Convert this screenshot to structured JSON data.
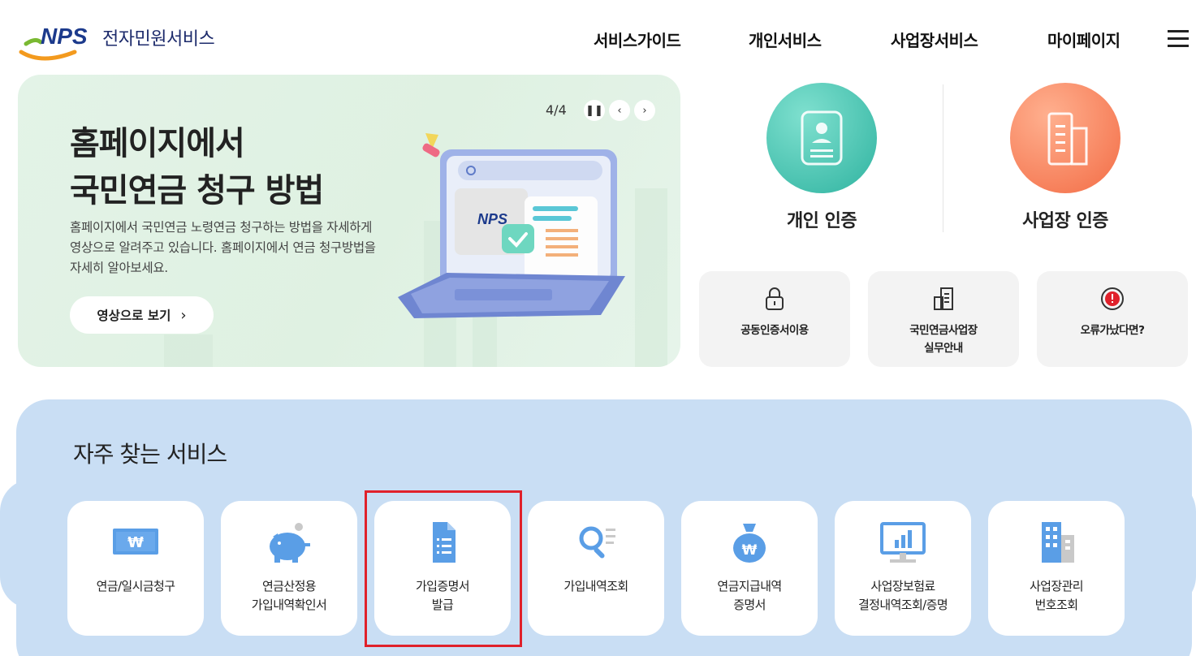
{
  "header": {
    "logo_mark": "NPS",
    "logo_text": "전자민원서비스",
    "nav": [
      "서비스가이드",
      "개인서비스",
      "사업장서비스",
      "마이페이지"
    ]
  },
  "banner": {
    "title_line1": "홈페이지에서",
    "title_line2": "국민연금 청구 방법",
    "description": "홈페이지에서 국민연금 노령연금 청구하는 방법을 자세하게 영상으로 알려주고 있습니다. 홈페이지에서 연금 청구방법을 자세히 알아보세요.",
    "button_label": "영상으로 보기",
    "pager": "4/4",
    "screen_logo": "NPS"
  },
  "auth": {
    "personal_label": "개인 인증",
    "business_label": "사업장 인증",
    "personal_color": "#3cbfae",
    "business_color": "#f7825a"
  },
  "quick_links": [
    {
      "line1": "공동인증서이용",
      "line2": "",
      "icon": "lock-icon"
    },
    {
      "line1": "국민연금사업장",
      "line2": "실무안내",
      "icon": "building-doc-icon"
    },
    {
      "line1": "오류가났다면?",
      "line2": "",
      "icon": "alert-icon"
    }
  ],
  "services": {
    "title": "자주 찾는 서비스",
    "items": [
      {
        "line1": "연금/일시금청구",
        "line2": "",
        "icon": "won-bill-icon"
      },
      {
        "line1": "연금산정용",
        "line2": "가입내역확인서",
        "icon": "piggy-bank-icon"
      },
      {
        "line1": "가입증명서",
        "line2": "발급",
        "icon": "document-icon"
      },
      {
        "line1": "가입내역조회",
        "line2": "",
        "icon": "search-list-icon"
      },
      {
        "line1": "연금지급내역",
        "line2": "증명서",
        "icon": "money-bag-icon"
      },
      {
        "line1": "사업장보험료",
        "line2": "결정내역조회/증명",
        "icon": "monitor-chart-icon"
      },
      {
        "line1": "사업장관리",
        "line2": "번호조회",
        "icon": "building-icon"
      }
    ]
  },
  "colors": {
    "accent_blue": "#5a9ee6",
    "highlight_red": "#e0212b",
    "service_bg": "#c9def4"
  }
}
